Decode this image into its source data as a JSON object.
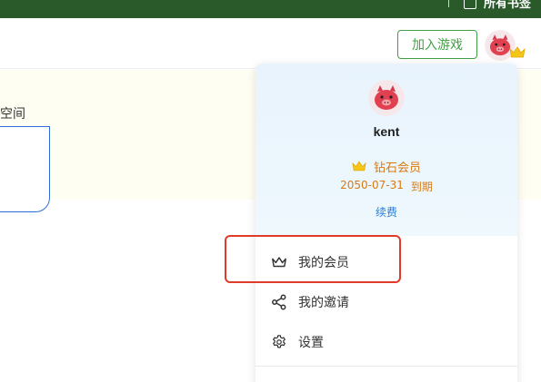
{
  "topbar": {
    "shelf_label": "所有书签",
    "icons": {
      "shelf": "bookmark-folder-icon"
    }
  },
  "header": {
    "join_game_label": "加入游戏",
    "avatar_icon": "pig-avatar-icon",
    "vip_badge_icon": "crown-icon"
  },
  "content": {
    "card_text": "空间"
  },
  "dropdown": {
    "username": "kent",
    "membership_level": "钻石会员",
    "membership_icon": "crown-icon",
    "expire_date": "2050-07-31",
    "expire_suffix": "到期",
    "renew_label": "续费",
    "menu": [
      {
        "label": "我的会员",
        "icon": "crown-outline-icon"
      },
      {
        "label": "我的邀请",
        "icon": "share-icon"
      },
      {
        "label": "设置",
        "icon": "gear-icon"
      }
    ]
  },
  "colors": {
    "topbar_bg": "#2a5a2a",
    "accent_green": "#43a047",
    "gold": "#d97a14",
    "link_blue": "#2d7dd6",
    "highlight_red": "#e03a2a"
  }
}
